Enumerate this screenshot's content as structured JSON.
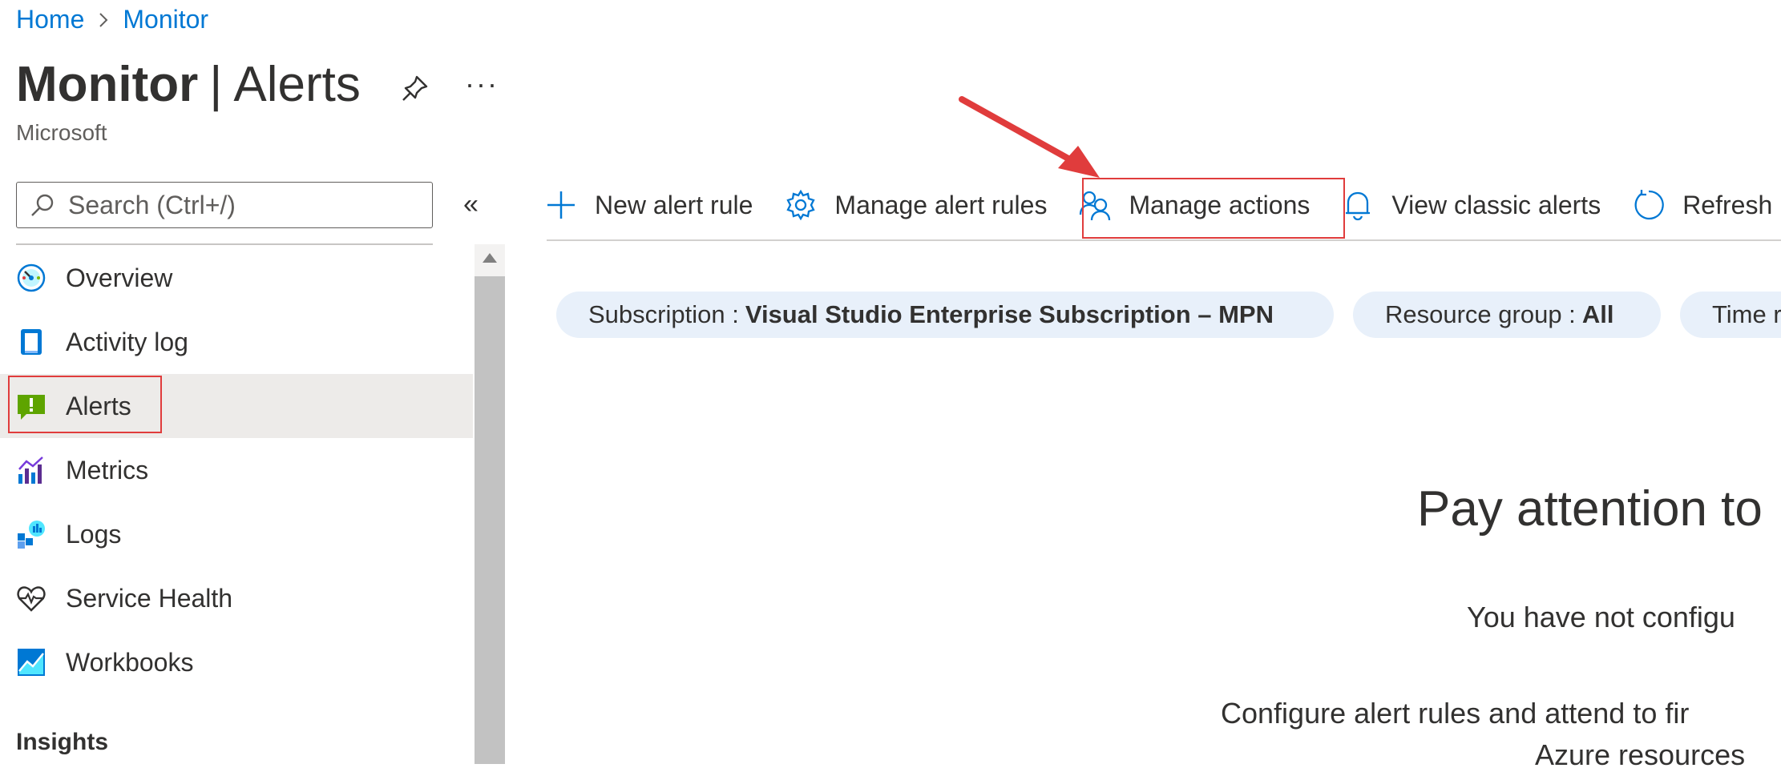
{
  "breadcrumb": {
    "items": [
      "Home",
      "Monitor"
    ]
  },
  "header": {
    "title_bold": "Monitor",
    "title_separator": "|",
    "title_rest": "Alerts",
    "more_label": "···",
    "org": "Microsoft"
  },
  "search": {
    "placeholder": "Search (Ctrl+/)",
    "collapse_label": "«"
  },
  "sidebar": {
    "items": [
      {
        "label": "Overview",
        "icon": "overview-gauge-icon"
      },
      {
        "label": "Activity log",
        "icon": "activity-log-icon"
      },
      {
        "label": "Alerts",
        "icon": "alerts-icon",
        "active": true
      },
      {
        "label": "Metrics",
        "icon": "metrics-icon"
      },
      {
        "label": "Logs",
        "icon": "logs-icon"
      },
      {
        "label": "Service Health",
        "icon": "service-health-icon"
      },
      {
        "label": "Workbooks",
        "icon": "workbooks-icon"
      }
    ],
    "section_header": "Insights"
  },
  "toolbar": {
    "new_alert_rule": "New alert rule",
    "manage_alert_rules": "Manage alert rules",
    "manage_actions": "Manage actions",
    "view_classic_alerts": "View classic alerts",
    "refresh": "Refresh"
  },
  "filters": {
    "subscription_label": "Subscription :",
    "subscription_value": "Visual Studio Enterprise Subscription – MPN",
    "resource_group_label": "Resource group :",
    "resource_group_value": "All",
    "time_label": "Time r"
  },
  "empty_state": {
    "title": "Pay attention to",
    "line1": "You have not configu",
    "line2": "Configure alert rules and attend to fir",
    "line3": "Azure resources"
  },
  "colors": {
    "accent": "#0078d4",
    "highlight": "#e03c3c",
    "pill_bg": "#e8f0fa",
    "active_row": "#edebe9"
  }
}
